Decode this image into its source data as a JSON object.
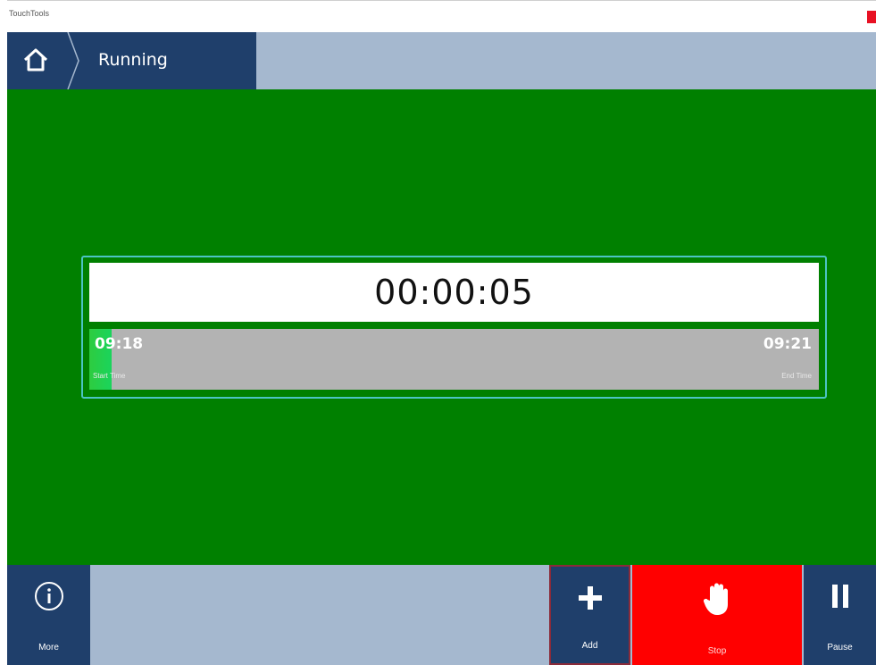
{
  "window": {
    "title": "TouchTools"
  },
  "nav": {
    "breadcrumb": "Running"
  },
  "timer": {
    "elapsed": "00:00:05",
    "start_time": "09:18",
    "start_label": "Start Time",
    "end_time": "09:21",
    "end_label": "End Time",
    "progress_fraction": 0.03
  },
  "toolbar": {
    "more_label": "More",
    "add_label": "Add",
    "stop_label": "Stop",
    "pause_label": "Pause"
  },
  "icons": {
    "home": "home-icon",
    "info": "info-icon",
    "add": "plus-icon",
    "stop": "hand-icon",
    "pause": "pause-icon",
    "close": "close-icon"
  },
  "colors": {
    "nav_dark": "#1f3f6b",
    "nav_light": "#a5b8cf",
    "running_bg": "#008000",
    "stop_red": "#ff0000",
    "panel_border": "#4cc4c4",
    "progress_track": "#b3b3b3",
    "progress_fill": "#2ecc40"
  }
}
